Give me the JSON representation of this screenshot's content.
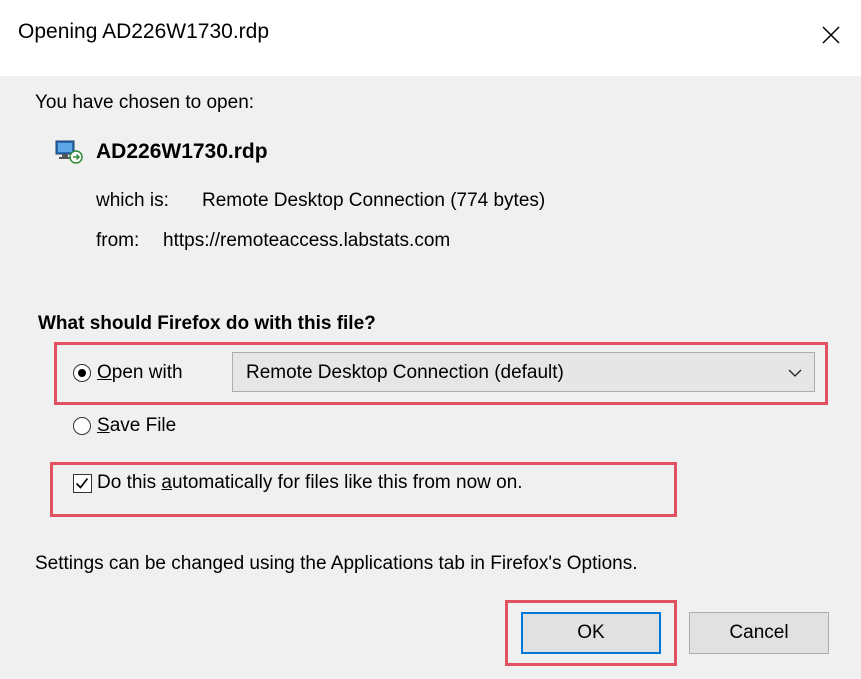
{
  "window": {
    "title": "Opening AD226W1730.rdp",
    "close_glyph": "✕"
  },
  "intro_text": "You have chosen to open:",
  "file": {
    "icon": "rdp-file-icon",
    "name": "AD226W1730.rdp",
    "which_is_label": "which is:",
    "which_is_value": "Remote Desktop Connection (774 bytes)",
    "from_label": "from:",
    "from_value": "https://remoteaccess.labstats.com"
  },
  "question": "What should Firefox do with this file?",
  "options": {
    "open_with": {
      "label_mnemonic": "O",
      "label_rest": "pen with",
      "selected": true
    },
    "open_with_app": {
      "value": "Remote Desktop Connection (default)",
      "icon": "chevron-down-icon"
    },
    "save_file": {
      "label_mnemonic": "S",
      "label_rest": "ave File",
      "selected": false
    }
  },
  "auto_checkbox": {
    "label_before": "Do this ",
    "label_mnemonic": "a",
    "label_after": "utomatically for files like this from now on.",
    "checked": true
  },
  "settings_note": "Settings can be changed using the Applications tab in Firefox's Options.",
  "buttons": {
    "ok_label": "OK",
    "cancel_label": "Cancel"
  },
  "colors": {
    "highlight": "#e05260",
    "default_button_border": "#0078d7",
    "dialog_background": "#f0f0f0"
  }
}
